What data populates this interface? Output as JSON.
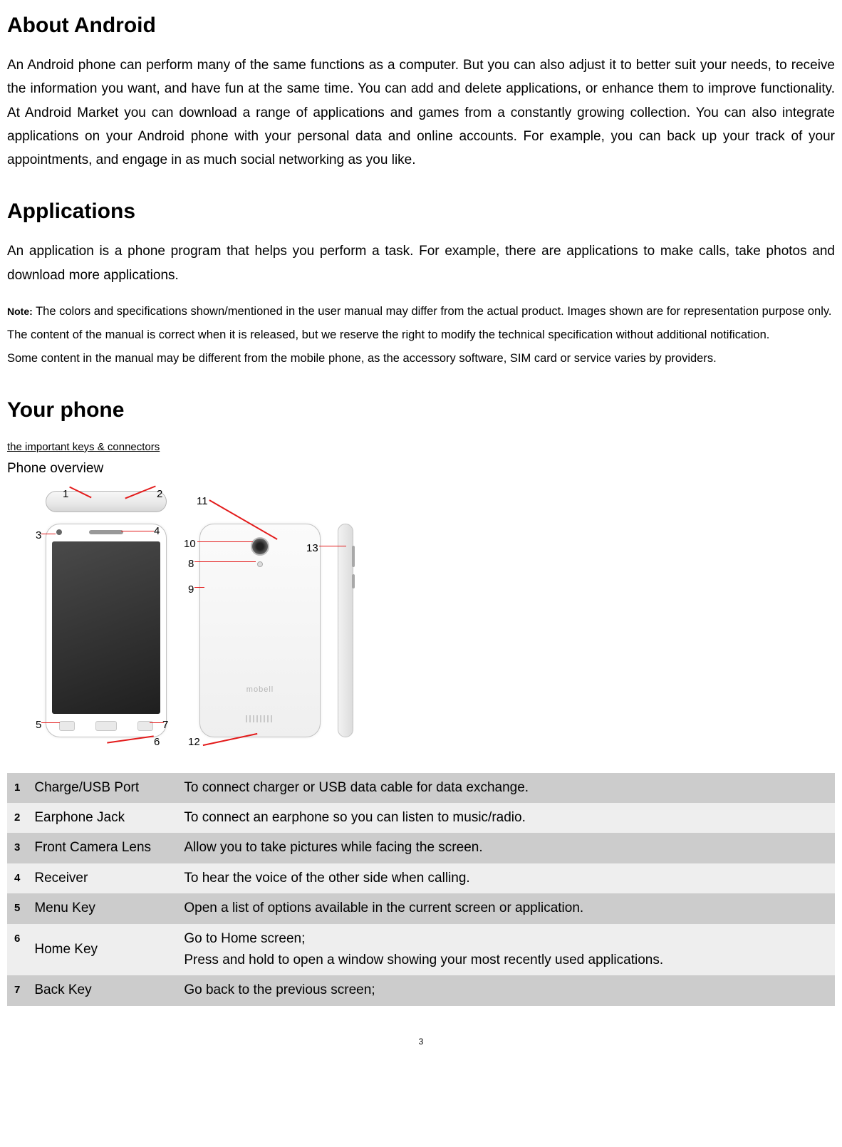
{
  "sections": {
    "about": {
      "heading": "About Android",
      "body": "An Android phone can perform many of the same functions as a computer. But you can also adjust it to better suit your needs, to receive the information you want, and have fun at the same time. You can add and delete applications, or enhance them to improve functionality. At Android Market you can download a range of applications and games from a constantly growing collection. You can also integrate applications on your Android phone with your personal data and online accounts. For example, you can back up your track of your appointments, and engage in as much social networking as you like."
    },
    "applications": {
      "heading": "Applications",
      "body": "An application is a phone program that helps you perform a task. For example, there are applications to make calls, take photos and download more applications."
    },
    "note": {
      "label": "Note:",
      "lines": [
        "The colors and specifications shown/mentioned in the user manual may differ from the actual product. Images shown are for representation purpose only.",
        "The content of the manual is correct when it is released, but we reserve the right to modify the technical specification without additional notification.",
        "Some content in the manual may be different from the mobile phone, as the accessory software, SIM card or service varies by providers."
      ]
    },
    "phone": {
      "heading": "Your phone",
      "subheading": "the important keys & connectors",
      "overview_label": "Phone overview",
      "brand_text": "mobell"
    }
  },
  "callouts": [
    "1",
    "2",
    "3",
    "4",
    "5",
    "6",
    "7",
    "8",
    "9",
    "10",
    "11",
    "12",
    "13"
  ],
  "table": {
    "rows": [
      {
        "idx": "1",
        "name": "Charge/USB Port",
        "desc": "To connect charger or USB data cable for data exchange."
      },
      {
        "idx": "2",
        "name": "Earphone Jack",
        "desc": "To connect an earphone so you can listen to music/radio."
      },
      {
        "idx": "3",
        "name": "Front Camera Lens",
        "desc": "Allow you to take pictures while facing the screen."
      },
      {
        "idx": "4",
        "name": "Receiver",
        "desc": "To hear the voice of the other side when calling."
      },
      {
        "idx": "5",
        "name": "Menu Key",
        "desc": "Open a list of options available in the current screen or application."
      },
      {
        "idx": "6",
        "name": "Home Key",
        "desc": "Go to Home screen;\nPress and hold to open a window showing your most recently used applications."
      },
      {
        "idx": "7",
        "name": "Back Key",
        "desc": "Go back to the previous screen;"
      }
    ]
  },
  "page_number": "3"
}
